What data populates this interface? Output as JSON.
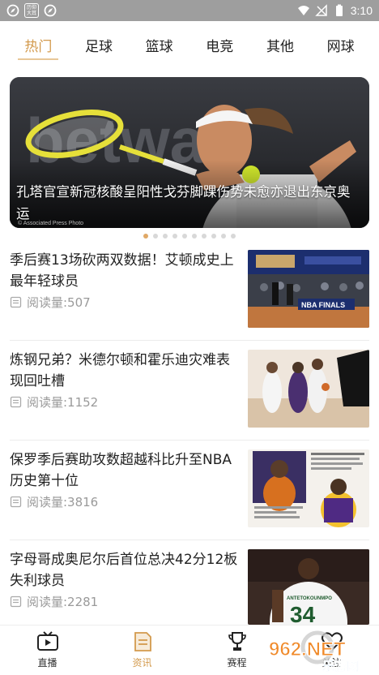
{
  "status_bar": {
    "badge_text": "历仰大耳",
    "time": "3:10"
  },
  "tabs": [
    {
      "label": "热门",
      "active": true
    },
    {
      "label": "足球",
      "active": false
    },
    {
      "label": "篮球",
      "active": false
    },
    {
      "label": "电竞",
      "active": false
    },
    {
      "label": "其他",
      "active": false
    },
    {
      "label": "网球",
      "active": false
    }
  ],
  "hero": {
    "title": "孔塔官宣新冠核酸呈阳性戈芬脚踝伤势未愈亦退出东京奥运",
    "photo_credit": "© Associated Press Photo",
    "brand_text": "betwa",
    "dot_count": 10,
    "active_dot": 0
  },
  "news": [
    {
      "title": "季后赛13场砍两双数据！艾顿成史上最年轻球员",
      "read_label": "阅读量:507",
      "thumb": "nba-finals-court"
    },
    {
      "title": "炼钢兄弟？米德尔顿和霍乐迪灾难表现回吐槽",
      "read_label": "阅读量:1152",
      "thumb": "bucks-vs-suns"
    },
    {
      "title": "保罗季后赛助攻数超越科比升至NBA历史第十位",
      "read_label": "阅读量:3816",
      "thumb": "chris-paul-kobe"
    },
    {
      "title": "字母哥成奥尼尔后首位总决42分12板失利球员",
      "read_label": "阅读量:2281",
      "thumb": "giannis-34"
    }
  ],
  "thumb_texts": {
    "nba_finals": "NBA FINALS",
    "jersey_number": "34",
    "jersey_name": "ANTETOKOUNMPO"
  },
  "bottom_nav": [
    {
      "label": "直播",
      "icon": "tv-icon",
      "active": false
    },
    {
      "label": "资讯",
      "icon": "document-icon",
      "active": true
    },
    {
      "label": "赛程",
      "icon": "trophy-icon",
      "active": false
    },
    {
      "label": "关注",
      "icon": "heart-icon",
      "active": false
    }
  ],
  "watermark": {
    "text": "962.NET",
    "subtext": "乐游网"
  },
  "colors": {
    "accent": "#d39a4d",
    "status_bar": "#9e9e9e",
    "meta_gray": "#9a9a9a"
  }
}
